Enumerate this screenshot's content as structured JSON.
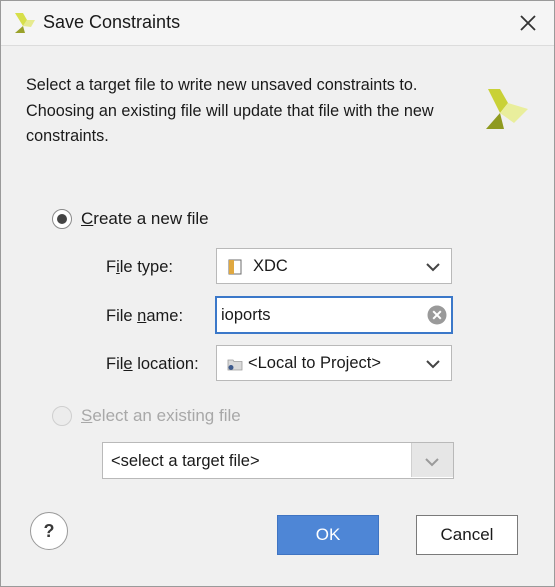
{
  "dialog": {
    "title": "Save Constraints",
    "intro": "Select a target file to write new unsaved constraints to. Choosing an existing file will update that file with the new constraints."
  },
  "options": {
    "create_new": {
      "label_first": "C",
      "label_rest": "reate a new file",
      "selected": true
    },
    "existing": {
      "label_first": "S",
      "label_rest": "elect an existing file",
      "selected": false
    }
  },
  "form": {
    "file_type": {
      "label_pre": "F",
      "label_u": "i",
      "label_post": "le type:",
      "value": "XDC"
    },
    "file_name": {
      "label_pre": "File ",
      "label_u": "n",
      "label_post": "ame:",
      "value": "ioports"
    },
    "file_location": {
      "label_pre": "Fil",
      "label_u": "e",
      "label_post": " location:",
      "value": "<Local to Project>"
    }
  },
  "existing_file": {
    "placeholder": "<select a target file>"
  },
  "buttons": {
    "help": "?",
    "ok": "OK",
    "cancel": "Cancel"
  },
  "colors": {
    "accent": "#4e86d6",
    "focus_border": "#3b78c9",
    "logo_yellow": "#e2e86a",
    "logo_olive": "#8f9a1f"
  }
}
